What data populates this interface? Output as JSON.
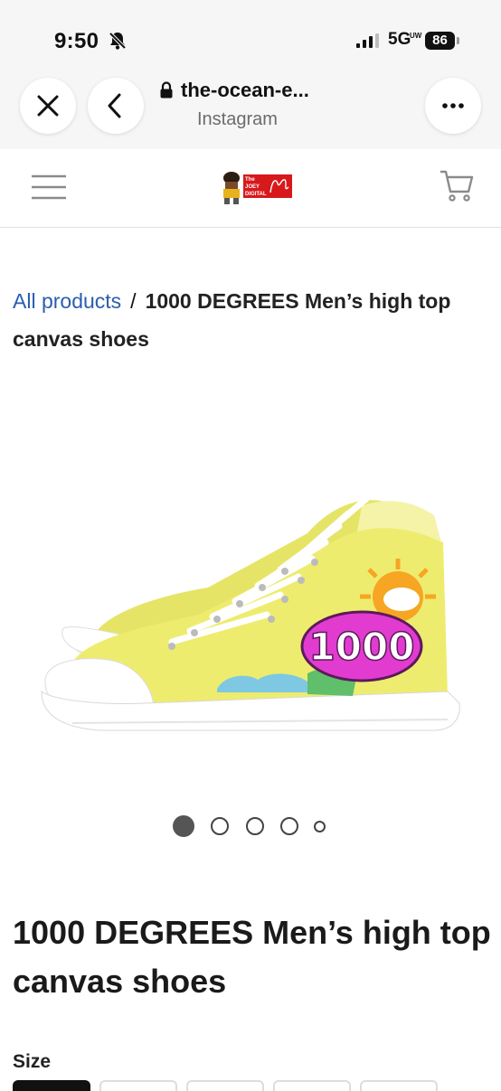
{
  "status_bar": {
    "time": "9:50",
    "network": "5G",
    "network_superscript": "UW",
    "battery": "86"
  },
  "browser": {
    "url": "the-ocean-e...",
    "source": "Instagram",
    "icons": [
      "close-icon",
      "back-icon",
      "lock-icon",
      "more-icon"
    ]
  },
  "site_header": {
    "icons": [
      "menu-icon",
      "cart-icon"
    ],
    "logo_text": [
      "The",
      "JOEY",
      "DIGITAL"
    ]
  },
  "breadcrumb": {
    "link": "All products",
    "separator": "/",
    "current": "1000 DEGREES Men’s high top canvas shoes"
  },
  "product": {
    "title": "1000 DEGREES Men’s high top canvas shoes",
    "image_graphic_text": "1000",
    "carousel": {
      "total": 5,
      "active_index": 0
    },
    "size_label": "Size"
  },
  "colors": {
    "link": "#2a5db0",
    "shoe_canvas": "#eeec6e",
    "graphic_pink": "#e23bd0"
  }
}
